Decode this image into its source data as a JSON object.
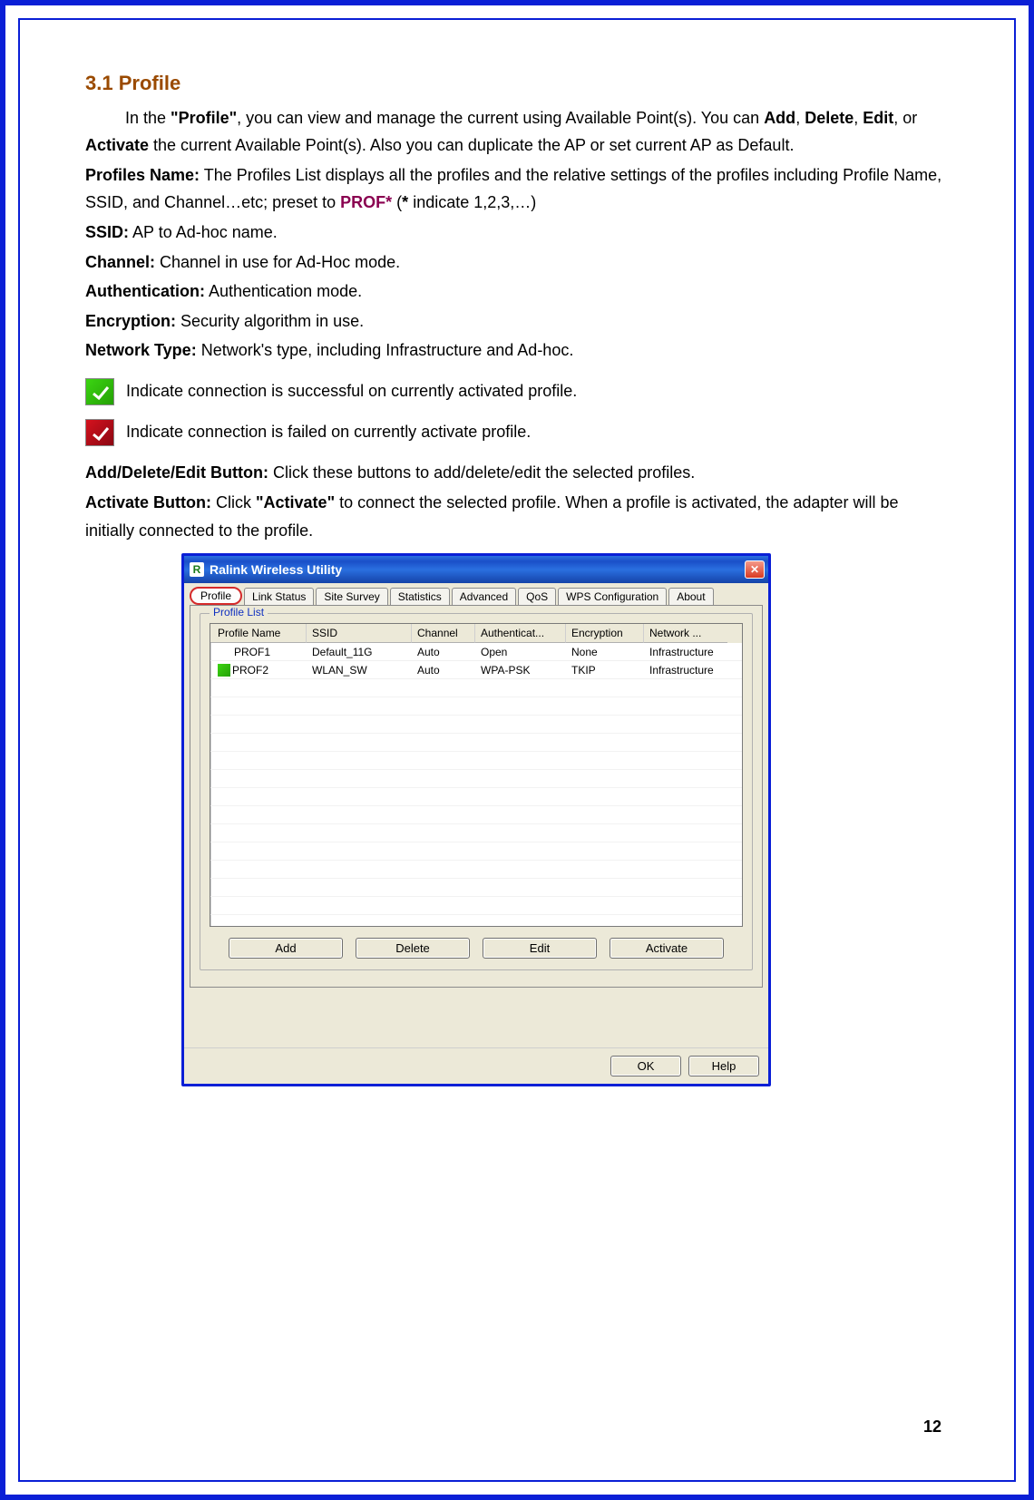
{
  "section": {
    "number": "3.1",
    "title": "Profile"
  },
  "intro": {
    "pre": "In the ",
    "bold1": "\"Profile\"",
    "mid1": ", you can view and manage the current using Available Point(s). You can ",
    "add": "Add",
    "c1": ", ",
    "delete": "Delete",
    "c2": ", ",
    "edit": "Edit",
    "c3": ", or ",
    "activate": "Activate",
    "tail": " the current Available Point(s). Also you can duplicate the AP or set current AP as Default."
  },
  "profilesName": {
    "label": "Profiles Name:",
    "pre": " The Profiles List displays all the profiles and the relative settings of the profiles including Profile Name, SSID, and Channel…etc; preset to ",
    "prof": "PROF*",
    "after": " (",
    "star": "*",
    "tail": " indicate 1,2,3,…)"
  },
  "ssid": {
    "label": "SSID:",
    "text": " AP to Ad-hoc name."
  },
  "channel": {
    "label": "Channel:",
    "text": " Channel in use for Ad-Hoc mode."
  },
  "auth": {
    "label": "Authentication:",
    "text": " Authentication mode."
  },
  "encryption": {
    "label": "Encryption:",
    "text": " Security algorithm in use."
  },
  "network": {
    "label": "Network Type:",
    "text": " Network's type, including Infrastructure and Ad-hoc."
  },
  "indicator": {
    "green": " Indicate connection is successful on currently activated profile.",
    "red": " Indicate connection is failed on currently activate profile."
  },
  "addDeleteEdit": {
    "label": "Add/Delete/Edit Button:",
    "text": " Click these buttons to add/delete/edit the selected profiles."
  },
  "activateBtn": {
    "label": "Activate Button:",
    "pre": " Click ",
    "bold": "\"Activate\"",
    "tail": " to connect the selected profile. When a profile is activated, the adapter will be initially connected to the profile."
  },
  "window": {
    "title": "Ralink Wireless Utility",
    "tabs": [
      "Profile",
      "Link Status",
      "Site Survey",
      "Statistics",
      "Advanced",
      "QoS",
      "WPS Configuration",
      "About"
    ],
    "groupLabel": "Profile List",
    "columns": [
      "Profile Name",
      "SSID",
      "Channel",
      "Authenticat...",
      "Encryption",
      "Network ..."
    ],
    "rows": [
      {
        "active": false,
        "profile": "PROF1",
        "ssid": "Default_11G",
        "channel": "Auto",
        "auth": "Open",
        "enc": "None",
        "net": "Infrastructure"
      },
      {
        "active": true,
        "profile": "PROF2",
        "ssid": "WLAN_SW",
        "channel": "Auto",
        "auth": "WPA-PSK",
        "enc": "TKIP",
        "net": "Infrastructure"
      }
    ],
    "buttons": {
      "add": "Add",
      "delete": "Delete",
      "edit": "Edit",
      "activate": "Activate",
      "ok": "OK",
      "help": "Help"
    }
  },
  "pageNumber": "12"
}
